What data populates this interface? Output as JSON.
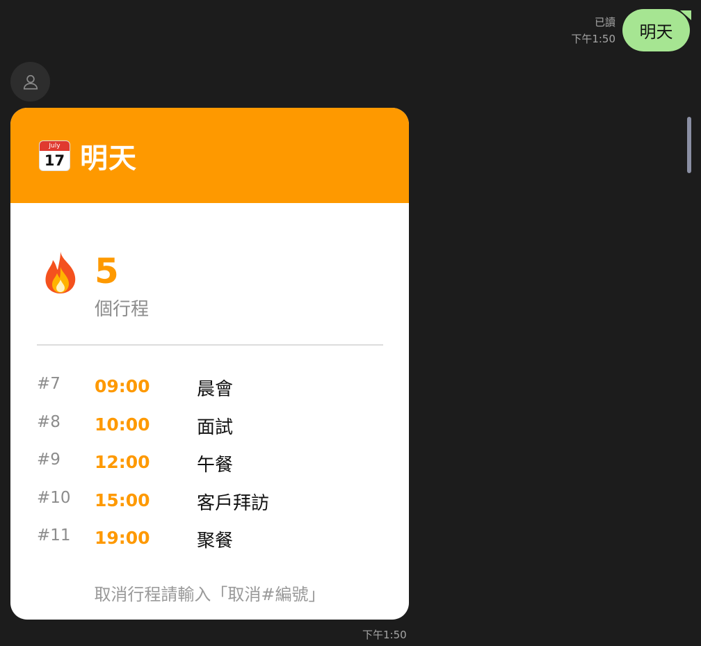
{
  "outgoing": {
    "read_status": "已讀",
    "time": "下午1:50",
    "text": "明天"
  },
  "incoming": {
    "avatar_icon": "user-icon",
    "time": "下午1:50",
    "card": {
      "header": {
        "icon": "calendar-icon",
        "calendar_month": "July",
        "calendar_day": "17",
        "title": "明天",
        "color": "#fe9900"
      },
      "summary": {
        "icon": "fire-icon",
        "count": "5",
        "label": "個行程"
      },
      "items": [
        {
          "num": "#7",
          "time": "09:00",
          "name": "晨會"
        },
        {
          "num": "#8",
          "time": "10:00",
          "name": "面試"
        },
        {
          "num": "#9",
          "time": "12:00",
          "name": "午餐"
        },
        {
          "num": "#10",
          "time": "15:00",
          "name": "客戶拜訪"
        },
        {
          "num": "#11",
          "time": "19:00",
          "name": "聚餐"
        }
      ],
      "note": "取消行程請輸入「取消#編號」"
    }
  },
  "colors": {
    "accent": "#fe9900",
    "outgoing_bubble": "#a6e592",
    "background": "#1c1c1c"
  }
}
